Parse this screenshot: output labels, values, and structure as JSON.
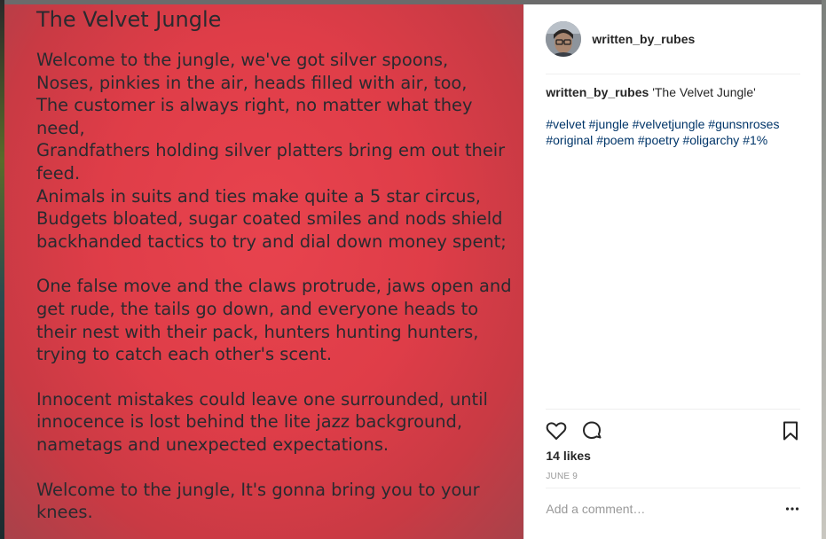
{
  "post": {
    "author": "written_by_rubes",
    "caption_title": "'The Velvet Jungle'",
    "hashtags": [
      "#velvet",
      "#jungle",
      "#velvetjungle",
      "#gunsnroses",
      "#original",
      "#poem",
      "#poetry",
      "#oligarchy",
      "#1%"
    ],
    "likes": "14 likes",
    "date": "JUNE 9",
    "comment_placeholder": "Add a comment…"
  },
  "poem": {
    "title": "The Velvet Jungle",
    "stanzas": [
      "Welcome to the jungle, we've got silver spoons,\nNoses, pinkies in the air, heads filled with air, too,\nThe customer is always right, no matter what they need,\nGrandfathers holding silver platters bring em out their feed.\nAnimals in suits and ties make quite a 5 star circus,\nBudgets bloated, sugar coated smiles and nods shield backhanded tactics to try and dial down money spent;",
      "One false move and the claws protrude, jaws open and get rude, the tails go down, and everyone heads to their nest with their pack, hunters hunting hunters, trying to catch each other's scent.",
      "Innocent mistakes could leave one surrounded, until innocence is lost behind the lite jazz background, nametags and unexpected expectations.",
      "Welcome to the jungle, It's gonna bring you to your knees."
    ]
  },
  "colors": {
    "image_background": "#df3d48",
    "poem_text": "#2a2a2f",
    "hashtag": "#003569",
    "muted": "#999999"
  },
  "icons": {
    "like": "heart-icon",
    "comment": "comment-bubble-icon",
    "save": "bookmark-icon",
    "more": "more-options-icon"
  }
}
